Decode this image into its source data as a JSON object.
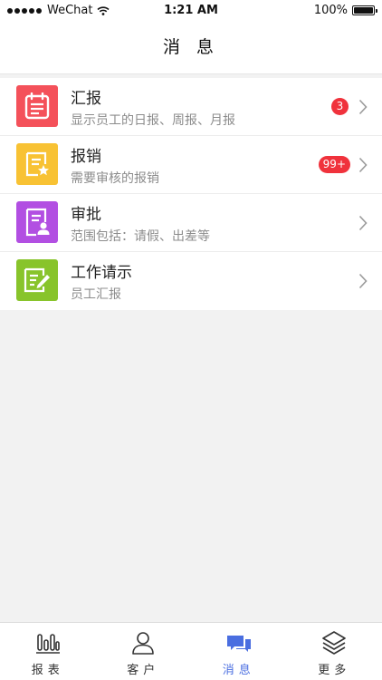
{
  "status_bar": {
    "carrier": "WeChat",
    "time": "1:21 AM",
    "battery": "100%",
    "battery_level": 1.0
  },
  "header": {
    "title": "消 息"
  },
  "items": [
    {
      "title": "汇报",
      "subtitle": "显示员工的日报、周报、月报",
      "badge": "3",
      "icon": "report-icon",
      "color": "#f4515a"
    },
    {
      "title": "报销",
      "subtitle": "需要审核的报销",
      "badge": "99+",
      "icon": "reimburse-icon",
      "color": "#f8c234"
    },
    {
      "title": "审批",
      "subtitle": "范围包括：请假、出差等",
      "badge": "",
      "icon": "approval-icon",
      "color": "#b24fe2"
    },
    {
      "title": "工作请示",
      "subtitle": "员工汇报",
      "badge": "",
      "icon": "request-icon",
      "color": "#88c42b"
    }
  ],
  "tabs": [
    {
      "label": "报表",
      "icon": "bar-chart-icon",
      "active": false
    },
    {
      "label": "客户",
      "icon": "user-icon",
      "active": false
    },
    {
      "label": "消息",
      "icon": "chat-icon",
      "active": true
    },
    {
      "label": "更多",
      "icon": "layers-icon",
      "active": false
    }
  ],
  "colors": {
    "accent": "#4a6ee0",
    "badge": "#f0323c",
    "background": "#f2f2f2"
  }
}
